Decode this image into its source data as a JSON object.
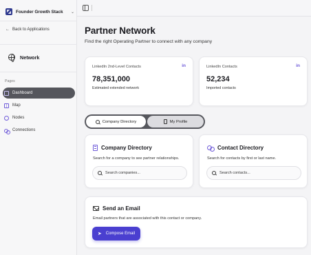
{
  "sidebar": {
    "brand": {
      "name": "Founder Growth Stack",
      "switch_icon": "⌄"
    },
    "back_label": "Back to Applications",
    "section_title": "Network",
    "pages_label": "Pages",
    "items": [
      {
        "label": "Dashboard",
        "icon": "dashboard-icon",
        "active": true
      },
      {
        "label": "Map",
        "icon": "map-icon"
      },
      {
        "label": "Nodes",
        "icon": "nodes-icon"
      },
      {
        "label": "Connections",
        "icon": "connections-icon"
      }
    ]
  },
  "header": {
    "title": "Partner Network",
    "subtitle": "Find the right Operating Partner to connect with any company"
  },
  "stats": [
    {
      "label": "LinkedIn 2nd-Level Contacts",
      "value": "78,351,000",
      "sub": "Estimated extended network",
      "icon": "in"
    },
    {
      "label": "LinkedIn Contacts",
      "value": "52,234",
      "sub": "Imported contacts",
      "icon": "in"
    }
  ],
  "tabs": [
    {
      "label": "Company Directory",
      "active": true
    },
    {
      "label": "My Profile",
      "active": false
    }
  ],
  "company_directory": {
    "title": "Company Directory",
    "description": "Search for a company to see partner relationships.",
    "placeholder": "Search companies..."
  },
  "contact_directory": {
    "title": "Contact Directory",
    "description": "Search for contacts by first or last name.",
    "placeholder": "Search contacts..."
  },
  "email": {
    "title": "Send an Email",
    "description": "Email partners that are associated with this contact or company.",
    "button_label": "Compose Email"
  },
  "colors": {
    "accent": "#4a3fd0",
    "icon_accent": "#6f5bd9",
    "active_nav": "#55565c"
  }
}
